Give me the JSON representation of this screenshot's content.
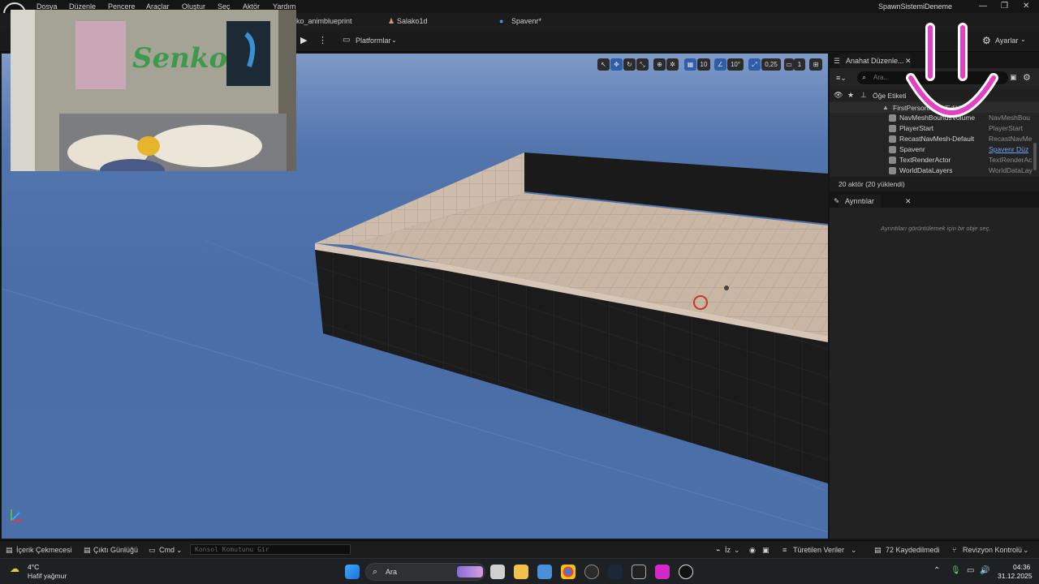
{
  "window": {
    "project_title": "SpawnSistemiDeneme",
    "controls": [
      "—",
      "❐",
      "✕"
    ]
  },
  "menu": [
    "Dosya",
    "Düzenle",
    "Pencere",
    "Araçlar",
    "Oluştur",
    "Seç",
    "Aktör",
    "Yardım"
  ],
  "tabs": [
    {
      "label": "ko_animblueprint"
    },
    {
      "label": "Salako1d"
    },
    {
      "label": "Spavenr*"
    }
  ],
  "toolbar": {
    "platforms_label": "Platformlar",
    "settings_label": "Ayarlar"
  },
  "viewport_toolbar": {
    "grid_snap": "10",
    "rotation_snap": "10°",
    "scale_snap": "0,25",
    "camera_speed": "1"
  },
  "outliner": {
    "tab_label": "Anahat Düzenle...",
    "search_placeholder": "Ara...",
    "column_label": "Öğe Etiketi",
    "root_label": "FirstPersonMap (Editör)",
    "items": [
      {
        "name": "NavMeshBoundsVolume",
        "type": "NavMeshBou"
      },
      {
        "name": "PlayerStart",
        "type": "PlayerStart"
      },
      {
        "name": "RecastNavMesh-Default",
        "type": "RecastNavMe"
      },
      {
        "name": "Spavenr",
        "type": "Spavenr Düz"
      },
      {
        "name": "TextRenderActor",
        "type": "TextRenderAc"
      },
      {
        "name": "WorldDataLayers",
        "type": "WorldDataLay"
      }
    ],
    "actor_count": "20 aktör (20 yüklendi)"
  },
  "details": {
    "tab_label": "Ayrıntılar",
    "empty_message": "Ayrıntıları görüntülemek için bir obje seç."
  },
  "statusbar": {
    "content_drawer": "İçerik Çekmecesi",
    "output_log": "Çıktı Günlüğü",
    "cmd_label": "Cmd",
    "console_placeholder": "Konsol Komutunu Gir",
    "trace_label": "İz",
    "derived_data": "Türetilen Veriler",
    "unsaved": "72 Kaydedilmedi",
    "revision_control": "Revizyon Kontrolü"
  },
  "taskbar": {
    "weather_temp": "4°C",
    "weather_desc": "Hafif yağmur",
    "search_label": "Ara",
    "time": "04:36",
    "date": "31.12.2025"
  },
  "webcam": {
    "wall_text": "Senko"
  },
  "colors": {
    "accent_blue": "#2f5ea8",
    "sky": "#4b6fa8",
    "floor": "#c8b5a4",
    "wall_dark": "#1e1e1e",
    "smiley": "#e53fc5"
  }
}
